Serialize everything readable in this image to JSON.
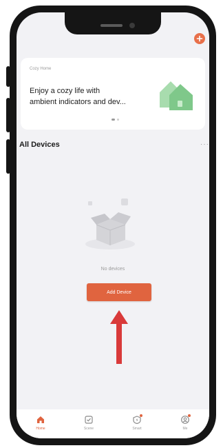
{
  "banner": {
    "small_title": "Cozy Home",
    "text": "Enjoy a cozy life with ambient indicators and dev..."
  },
  "section": {
    "title": "All Devices",
    "more": "···"
  },
  "empty_state": {
    "message": "No devices",
    "button_label": "Add Device"
  },
  "tabs": [
    {
      "label": "Home",
      "icon": "home-icon",
      "active": true
    },
    {
      "label": "Scene",
      "icon": "scene-icon",
      "active": false
    },
    {
      "label": "Smart",
      "icon": "smart-icon",
      "active": false
    },
    {
      "label": "Me",
      "icon": "me-icon",
      "active": false
    }
  ],
  "colors": {
    "accent": "#e0643f",
    "background": "#f2f2f5",
    "arrow": "#d93a3a"
  }
}
